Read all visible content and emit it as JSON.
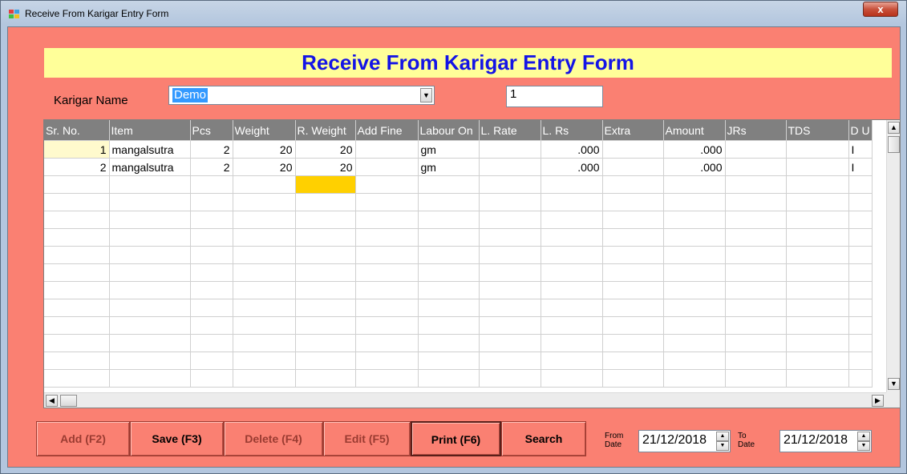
{
  "window": {
    "title": "Receive From Karigar Entry Form",
    "close_label": "x"
  },
  "form": {
    "heading": "Receive From Karigar Entry Form",
    "karigar_label": "Karigar Name",
    "karigar_value": "Demo",
    "entry_number": "1"
  },
  "grid": {
    "columns": [
      "Sr. No.",
      "Item",
      "Pcs",
      "Weight",
      "R. Weight",
      "Add Fine",
      "Labour On",
      "L. Rate",
      "L. Rs",
      "Extra",
      "Amount",
      "JRs",
      "TDS",
      "D U"
    ],
    "rows": [
      [
        "1",
        "mangalsutra",
        "2",
        "20",
        "20",
        "",
        "gm",
        "",
        ".000",
        "",
        ".000",
        "",
        "",
        "I"
      ],
      [
        "2",
        "mangalsutra",
        "2",
        "20",
        "20",
        "",
        "gm",
        "",
        ".000",
        "",
        ".000",
        "",
        "",
        "I"
      ]
    ]
  },
  "buttons": {
    "add": "Add (F2)",
    "save": "Save (F3)",
    "delete": "Delete (F4)",
    "edit": "Edit (F5)",
    "print": "Print (F6)",
    "search": "Search"
  },
  "dates": {
    "from_label_1": "From",
    "from_label_2": "Date",
    "from_value": "21/12/2018",
    "to_label_1": "To",
    "to_label_2": "Date",
    "to_value": "21/12/2018"
  },
  "colors": {
    "form_background": "#fa8072",
    "heading_background": "#ffff99",
    "heading_text": "#1414e6",
    "grid_header": "#808080",
    "active_cell": "#ffd000"
  },
  "icons": {
    "scroll_up": "▲",
    "scroll_down": "▼",
    "scroll_left": "◀",
    "scroll_right": "▶",
    "combo_arrow": "▼"
  }
}
